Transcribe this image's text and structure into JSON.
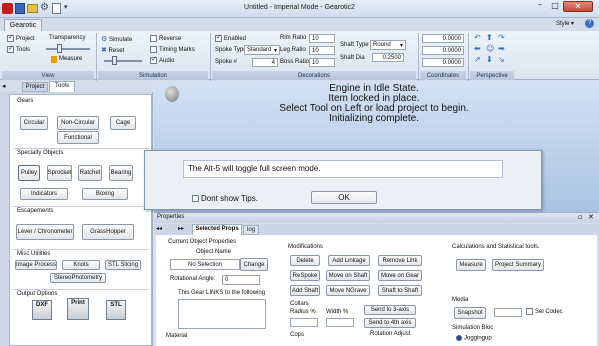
{
  "window": {
    "title": "Untitled - Imperial Mode - Gearotic2",
    "style_label": "Style"
  },
  "ribbon": {
    "tab_label": "Gearotic",
    "view": {
      "caption": "View",
      "project": "Project",
      "tools": "Tools",
      "transparency": "Transparency",
      "measure": "Measure"
    },
    "simulation": {
      "caption": "Simulation",
      "simulate": "Simulate",
      "reset": "Reset",
      "reverse": "Reverse",
      "timing_marks": "Timing Marks",
      "audio": "Audio"
    },
    "decorations": {
      "caption": "Decorations",
      "enabled": "Enabled",
      "spoke_type_label": "Spoke Type",
      "spoke_type_value": "Standard",
      "spoke_num_label": "Spoke #",
      "spoke_num_value": "4",
      "rim_ratio_label": "Rim Ratio",
      "rim_ratio_value": "10",
      "leg_ratio_label": "Leg Ratio",
      "leg_ratio_value": "10",
      "boss_ratio_label": "Boss Ratio",
      "boss_ratio_value": "10",
      "shaft_type_label": "Shaft Type",
      "shaft_type_value": "Round",
      "shaft_dia_label": "Shaft Dia",
      "shaft_dia_value": "0.2500"
    },
    "coordinates": {
      "caption": "Coordinates",
      "x": "0.0000",
      "y": "0.0000",
      "z": "0.0000"
    },
    "perspective": {
      "caption": "Perspective"
    }
  },
  "left_panel": {
    "tabs": [
      "Project",
      "Tools"
    ],
    "gears": {
      "title": "Gears",
      "buttons": [
        "Circular",
        "Non-Circular",
        "Cage",
        "Functional"
      ]
    },
    "specialty": {
      "title": "Specialty Objects",
      "buttons": [
        "Pulley",
        "Sprocket",
        "Ratchet",
        "Bearing",
        "Indicators",
        "Boxing"
      ]
    },
    "escapements": {
      "title": "Escapements",
      "buttons": [
        "Lever / Chronometer",
        "GrassHopper"
      ]
    },
    "misc": {
      "title": "Misc Utilities",
      "buttons": [
        "Image Process",
        "Knots",
        "STL Slicing",
        "StereoPhotometry"
      ]
    },
    "output": {
      "title": "Output Options",
      "icons": [
        "DXF",
        "Print",
        "STL"
      ]
    }
  },
  "viewport": {
    "status_lines": [
      "Engine in Idle State.",
      "Item locked in place.",
      "Select Tool on Left or load project to begin.",
      "Initializing complete."
    ]
  },
  "tip_dialog": {
    "message": "The Alt-5 will toggle full screen mode.",
    "dont_show_label": "Dont show Tips.",
    "ok_label": "OK"
  },
  "properties": {
    "title": "Properties",
    "tabs": [
      "Selected Props",
      "log"
    ],
    "current_object": {
      "title": "Current Object Properties",
      "object_name_label": "Object Name",
      "object_name_value": "No Selection",
      "change_label": "Change",
      "rotational_angle_label": "Rotational Angle:",
      "rotational_angle_value": "0",
      "links_label": "This Gear LINKS to the following",
      "material_label": "Material"
    },
    "modifications": {
      "title": "Modifications",
      "delete": "Delete",
      "add_linkage": "Add Linkage",
      "remove_link": "Remove Link",
      "respoke": "ReSpoke",
      "move_on_shaft": "Move on Shaft",
      "move_on_gear": "Move on Gear",
      "add_shaft": "Add Shaft",
      "move_ngrave": "Move NGrave",
      "shaft_to_shaft": "Shaft to Shaft",
      "collars_label": "Collars",
      "radius_label": "Radius %",
      "width_label": "Width %",
      "send_3rd": "Send to 3-axis",
      "send_4th": "Send to 4th axis",
      "rotation_adjust": "Rotation Adjust",
      "cops_label": "Cops"
    },
    "calc": {
      "title": "Calculations and Statistical tools.",
      "measure": "Measure",
      "project_summary": "Project Summary",
      "media_title": "Media",
      "snapshot": "Snapshot",
      "sel_codec": "Sel Codec",
      "simulation_bloc": "Simulation Bloc",
      "joggingup": "Joggingup"
    }
  },
  "colors": {
    "viewport_bg": "#b7cde9",
    "ribbon_bg": "#dfe7f2",
    "panel_bg": "#ffffff",
    "title_bar": "#d9e4f2"
  }
}
